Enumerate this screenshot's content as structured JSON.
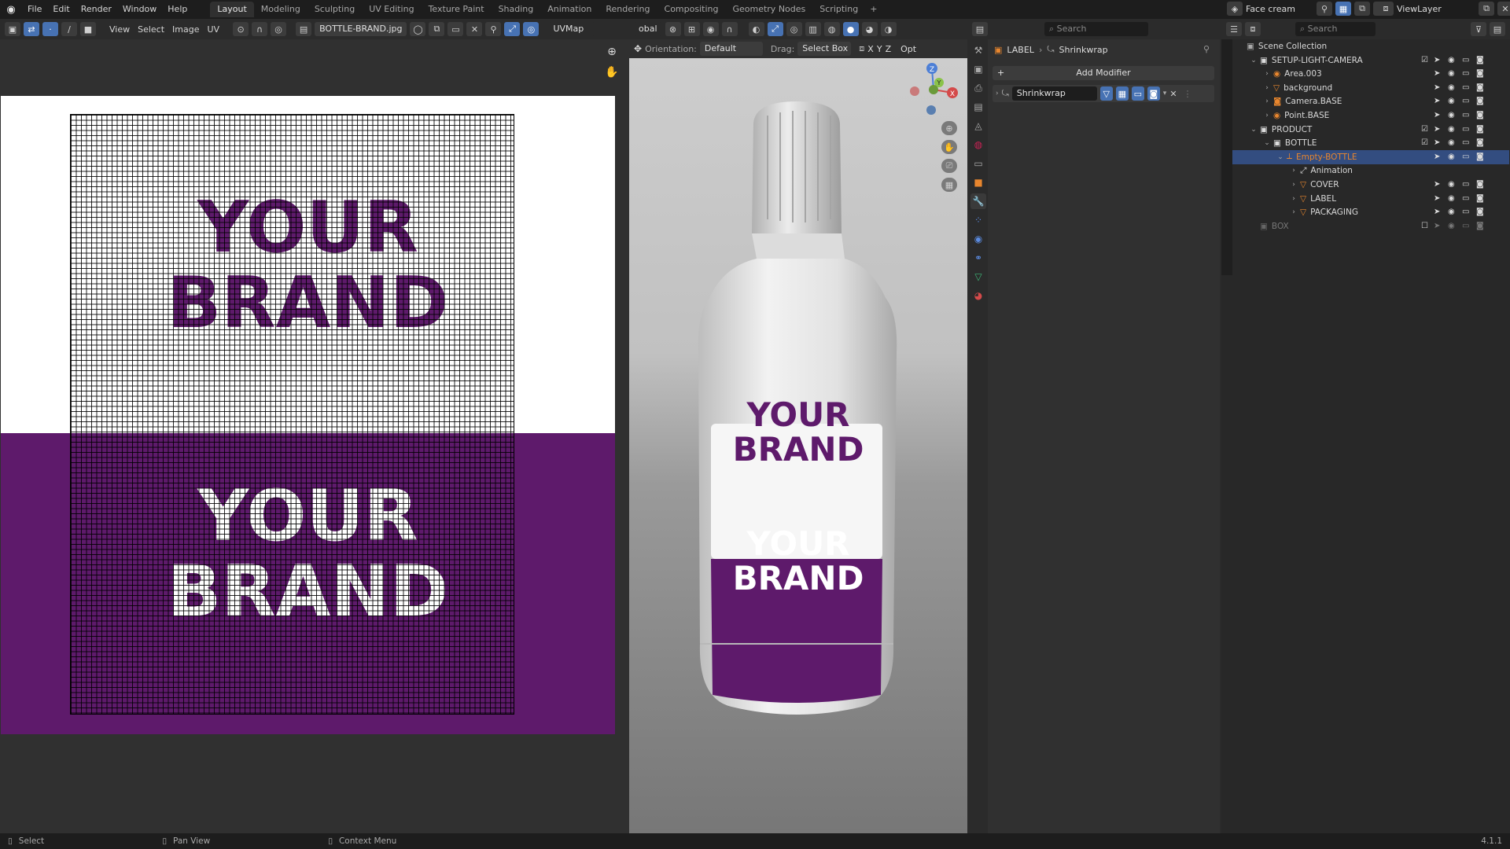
{
  "topbar": {
    "menus": [
      "File",
      "Edit",
      "Render",
      "Window",
      "Help"
    ],
    "workspaces": [
      "Layout",
      "Modeling",
      "Sculpting",
      "UV Editing",
      "Texture Paint",
      "Shading",
      "Animation",
      "Rendering",
      "Compositing",
      "Geometry Nodes",
      "Scripting"
    ],
    "active_workspace": "Layout",
    "add_workspace": "+",
    "scene_name": "Face cream",
    "view_layer": "ViewLayer"
  },
  "uv_editor": {
    "menus": [
      "View",
      "Select",
      "Image",
      "UV"
    ],
    "image_name": "BOTTLE-BRAND.jpg",
    "uvmap": "UVMap",
    "texture_top_text": [
      "YOUR",
      "BRAND"
    ],
    "texture_bottom_text": [
      "YOUR",
      "BRAND"
    ]
  },
  "viewport": {
    "transform_space": "obal",
    "orientation_label": "Orientation:",
    "orientation_value": "Default",
    "drag_label": "Drag:",
    "drag_value": "Select Box",
    "axis_x": "X",
    "axis_y": "Y",
    "axis_z": "Z",
    "options_label": "Opt",
    "label_top_text": [
      "YOUR",
      "BRAND"
    ],
    "label_bottom_text": [
      "YOUR",
      "BRAND"
    ]
  },
  "properties": {
    "search_placeholder": "Search",
    "breadcrumb_object": "LABEL",
    "breadcrumb_modifier": "Shrinkwrap",
    "add_modifier": "Add Modifier",
    "modifier_name": "Shrinkwrap"
  },
  "outliner": {
    "search_placeholder": "Search",
    "rows": [
      {
        "label": "Scene Collection",
        "depth": 0,
        "type": "scene",
        "chev": "",
        "sel": false,
        "vis": false,
        "cb": "",
        "dim": false
      },
      {
        "label": "SETUP-LIGHT-CAMERA",
        "depth": 1,
        "type": "collection",
        "chev": "v",
        "sel": false,
        "vis": true,
        "cb": "✓",
        "dim": false
      },
      {
        "label": "Area.003",
        "depth": 2,
        "type": "light",
        "chev": ">",
        "sel": false,
        "vis": true,
        "cb": "",
        "dim": false
      },
      {
        "label": "background",
        "depth": 2,
        "type": "mesh",
        "chev": ">",
        "sel": false,
        "vis": true,
        "cb": "",
        "dim": false
      },
      {
        "label": "Camera.BASE",
        "depth": 2,
        "type": "camera",
        "chev": ">",
        "sel": false,
        "vis": true,
        "cb": "",
        "dim": false
      },
      {
        "label": "Point.BASE",
        "depth": 2,
        "type": "light",
        "chev": ">",
        "sel": false,
        "vis": true,
        "cb": "",
        "dim": false
      },
      {
        "label": "PRODUCT",
        "depth": 1,
        "type": "collection",
        "chev": "v",
        "sel": false,
        "vis": true,
        "cb": "✓",
        "dim": false
      },
      {
        "label": "BOTTLE",
        "depth": 2,
        "type": "collection",
        "chev": "v",
        "sel": false,
        "vis": true,
        "cb": "✓",
        "dim": false
      },
      {
        "label": "Empty-BOTTLE",
        "depth": 3,
        "type": "empty",
        "chev": "v",
        "sel": true,
        "vis": true,
        "cb": "",
        "dim": false
      },
      {
        "label": "Animation",
        "depth": 4,
        "type": "anim",
        "chev": ">",
        "sel": false,
        "vis": false,
        "cb": "",
        "dim": false
      },
      {
        "label": "COVER",
        "depth": 4,
        "type": "mesh",
        "chev": ">",
        "sel": false,
        "vis": true,
        "cb": "",
        "dim": false
      },
      {
        "label": "LABEL",
        "depth": 4,
        "type": "mesh",
        "chev": ">",
        "sel": false,
        "vis": true,
        "cb": "",
        "dim": false
      },
      {
        "label": "PACKAGING",
        "depth": 4,
        "type": "mesh",
        "chev": ">",
        "sel": false,
        "vis": true,
        "cb": "",
        "dim": false
      },
      {
        "label": "BOX",
        "depth": 1,
        "type": "collection",
        "chev": "",
        "sel": false,
        "vis": true,
        "cb": "□",
        "dim": true
      }
    ]
  },
  "statusbar": {
    "select": "Select",
    "pan_view": "Pan View",
    "context_menu": "Context Menu",
    "version": "4.1.1"
  },
  "colors": {
    "brand_purple": "#5e1a6b",
    "selection_blue": "#334d80",
    "active_orange": "#e8862e"
  }
}
